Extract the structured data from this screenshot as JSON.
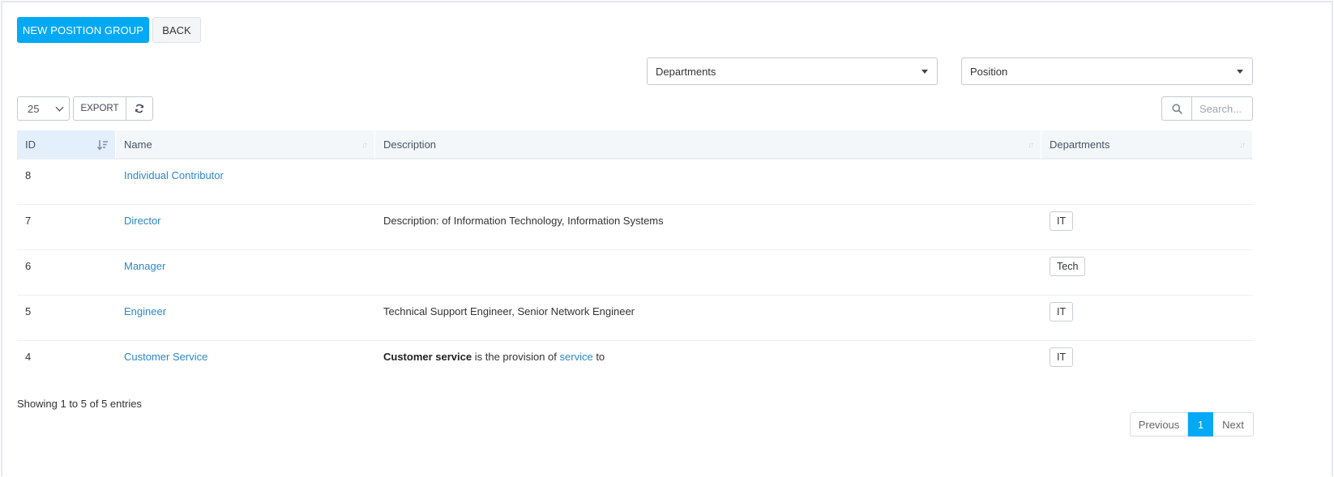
{
  "toolbar": {
    "new_label": "NEW POSITION GROUP",
    "back_label": "BACK"
  },
  "filters": {
    "departments_value": "Departments",
    "position_value": "Position"
  },
  "table_controls": {
    "page_length": "25",
    "export_label": "EXPORT",
    "search_placeholder": "Search..."
  },
  "table": {
    "columns": [
      "ID",
      "Name",
      "Description",
      "Departments"
    ],
    "rows": [
      {
        "id": "8",
        "name": "Individual Contributor",
        "description": "",
        "department": ""
      },
      {
        "id": "7",
        "name": "Director",
        "description": "Description: of Information Technology, Information Systems",
        "department": "IT"
      },
      {
        "id": "6",
        "name": "Manager",
        "description": "",
        "department": "Tech"
      },
      {
        "id": "5",
        "name": "Engineer",
        "description": "Technical Support Engineer, Senior Network Engineer",
        "department": "IT"
      },
      {
        "id": "4",
        "name": "Customer Service",
        "description_parts": {
          "bold": "Customer service",
          "mid": " is the provision of ",
          "link": "service",
          "end": " to"
        },
        "department": "IT"
      }
    ]
  },
  "footer": {
    "info": "Showing 1 to 5 of 5 entries",
    "prev_label": "Previous",
    "current_page": "1",
    "next_label": "Next"
  },
  "colors": {
    "primary": "#03a9f4",
    "link": "#2c87c8",
    "header_bg": "#f4f7fa"
  },
  "icons": {
    "refresh": "refresh-icon",
    "search": "search-icon",
    "sort": "sort-desc-icon"
  }
}
